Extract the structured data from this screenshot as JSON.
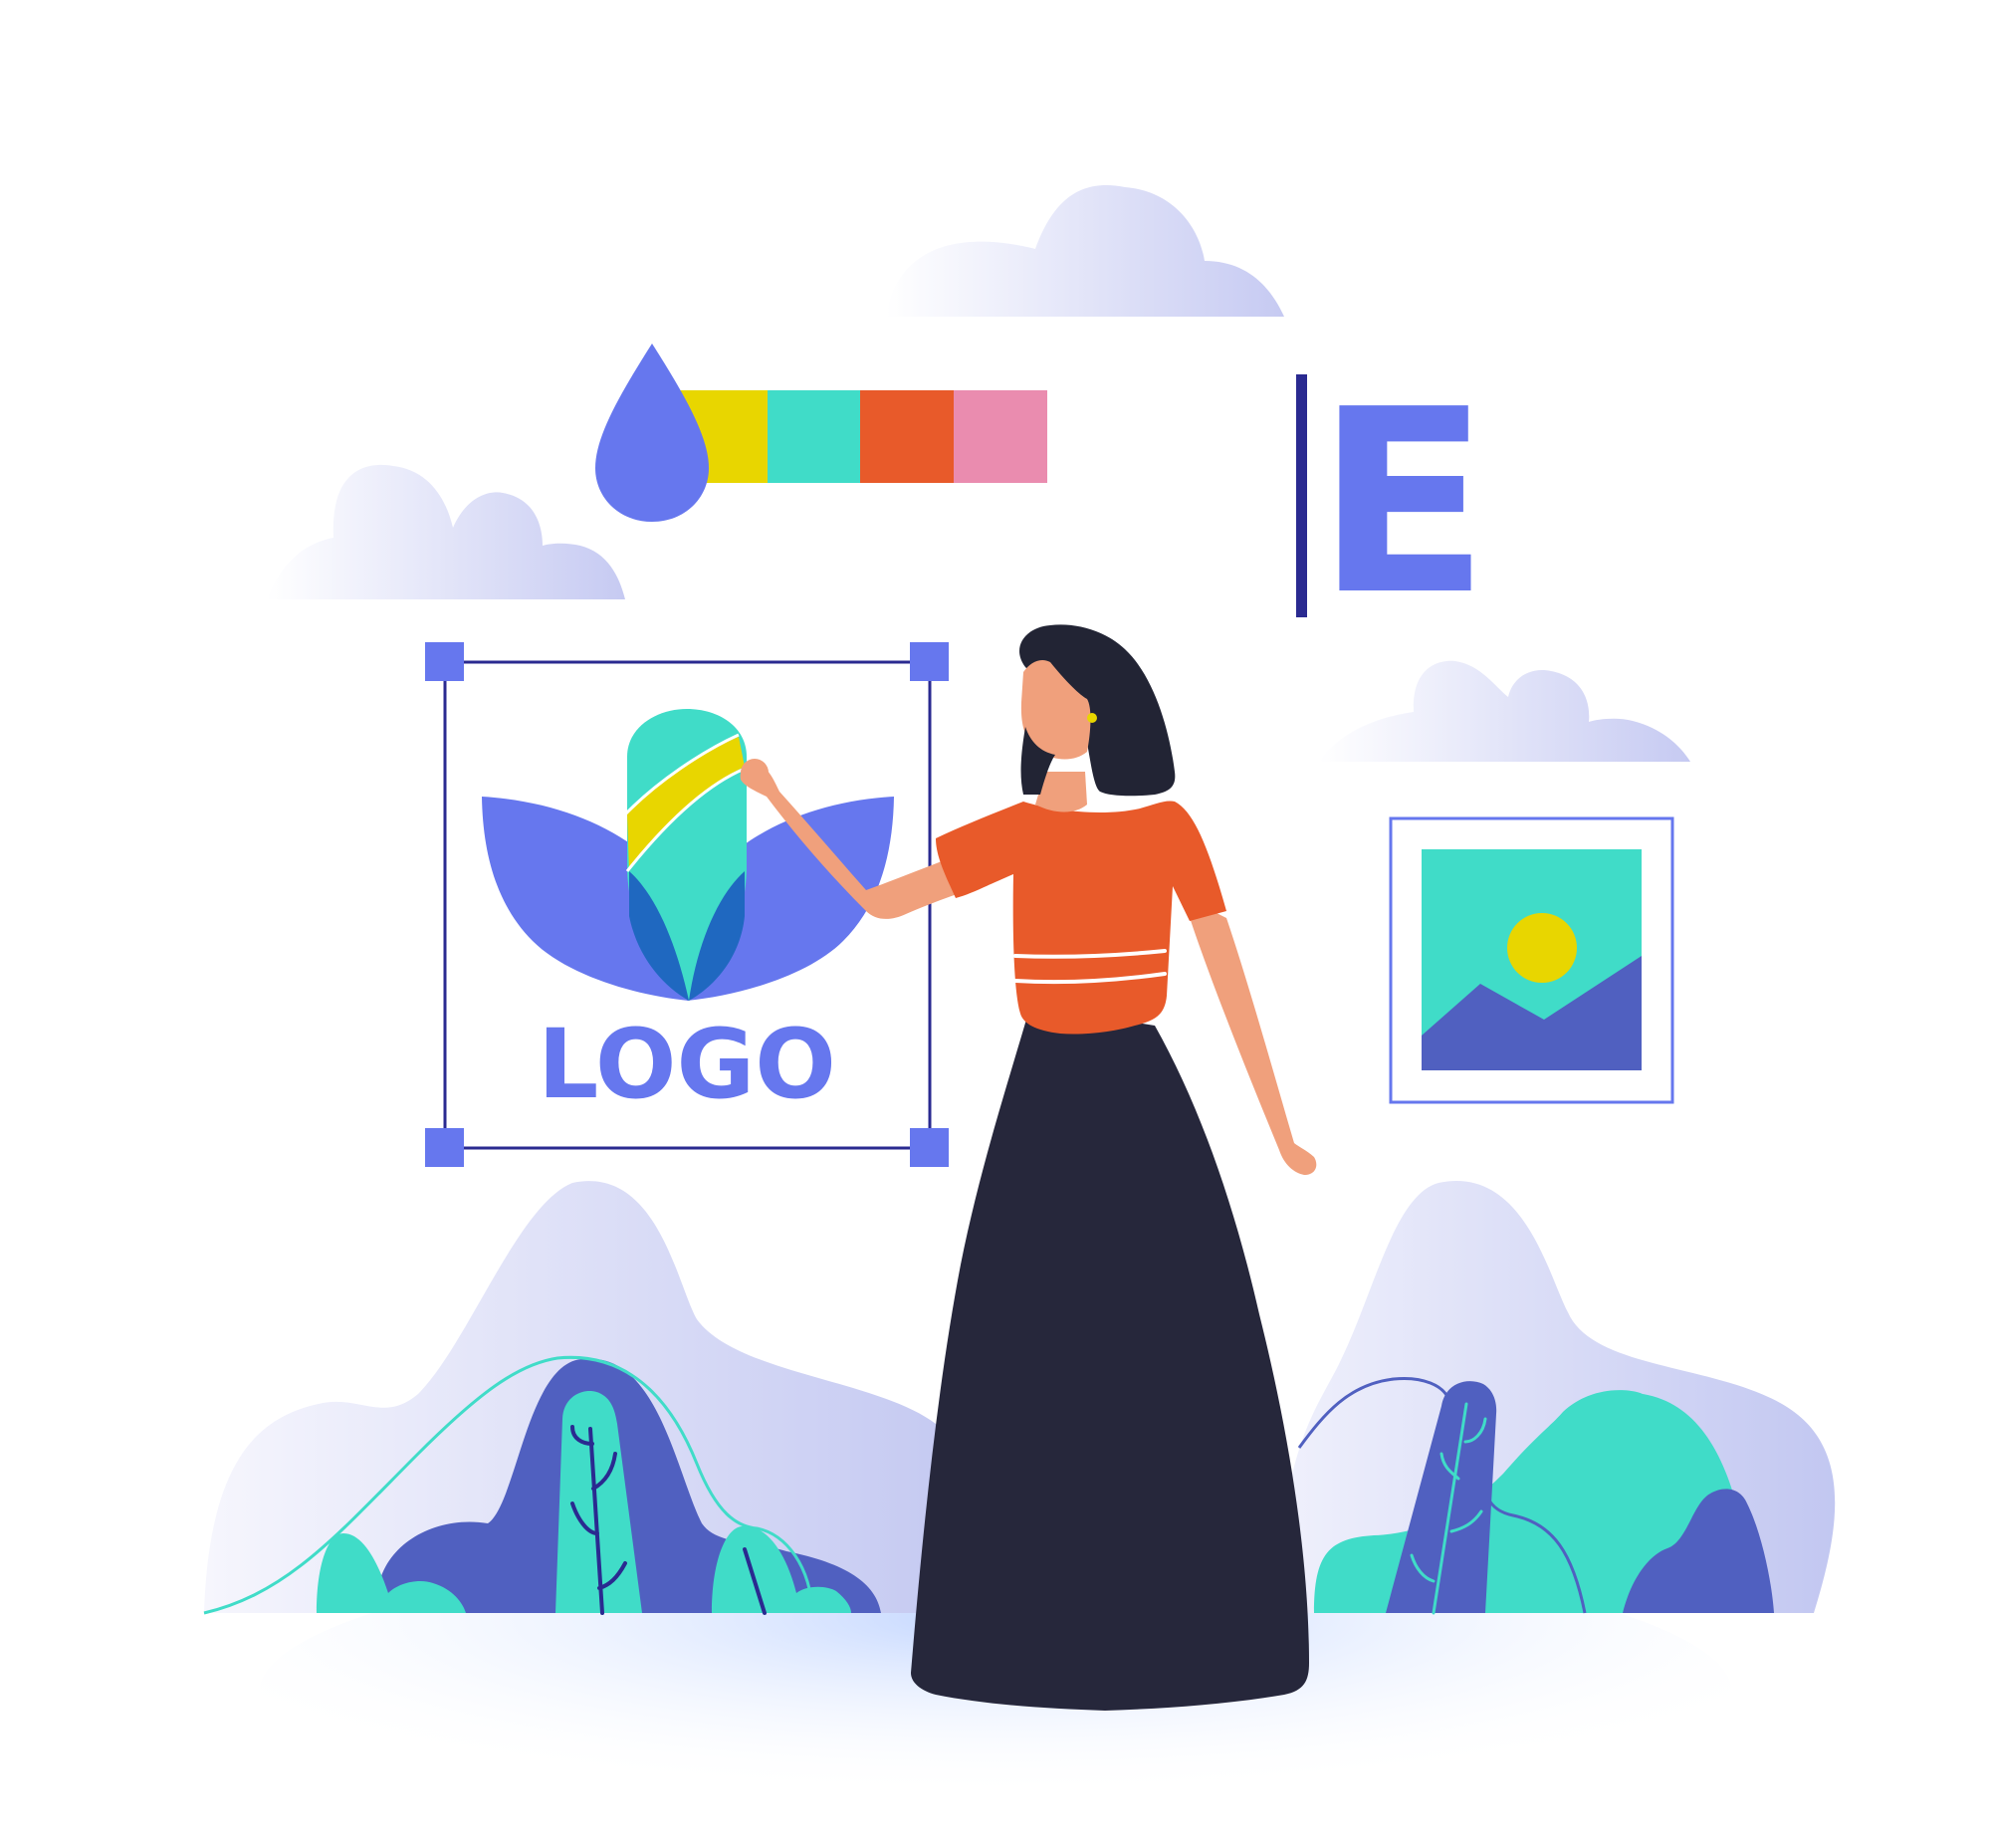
{
  "illustration": {
    "logo_text": "LOGO",
    "typography_letter": "E"
  },
  "palette": {
    "brand": "#6677ee",
    "navy": "#2a2a90",
    "deep_blue": "#5060c0",
    "teal": "#40dcc8",
    "yellow": "#e8d600",
    "orange": "#e85a2a",
    "pink": "#ea8caf",
    "skin": "#f0a07c",
    "hair": "#222434",
    "skirt": "#26273b",
    "swatches": [
      "#e8d600",
      "#40dcc8",
      "#e85a2a",
      "#ea8caf"
    ]
  },
  "icons": {
    "color_drop": "color-drop-icon",
    "image_frame": "image-placeholder-icon",
    "text_cursor": "text-cursor-icon",
    "selection_handles": "selection-handle-icon"
  }
}
